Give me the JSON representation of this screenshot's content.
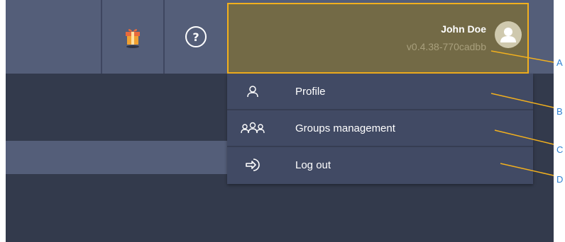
{
  "user": {
    "name": "John Doe",
    "version": "v0.4.38-770cadbb"
  },
  "menu": {
    "items": [
      {
        "label": "Profile",
        "icon": "user-icon"
      },
      {
        "label": "Groups management",
        "icon": "users-group-icon"
      },
      {
        "label": "Log out",
        "icon": "logout-icon"
      }
    ]
  },
  "topbar": {
    "help_glyph": "?",
    "icons": [
      "gift-icon",
      "help-icon"
    ]
  },
  "annotations": {
    "callouts": [
      "A",
      "B",
      "C",
      "D"
    ],
    "color": "#2e7fd0",
    "line_color": "#f2b01e"
  },
  "colors": {
    "topbar": "#545e79",
    "background": "#333a4c",
    "menu": "#414a64",
    "user_panel": "#736a46",
    "highlight_border": "#f2b01e"
  }
}
